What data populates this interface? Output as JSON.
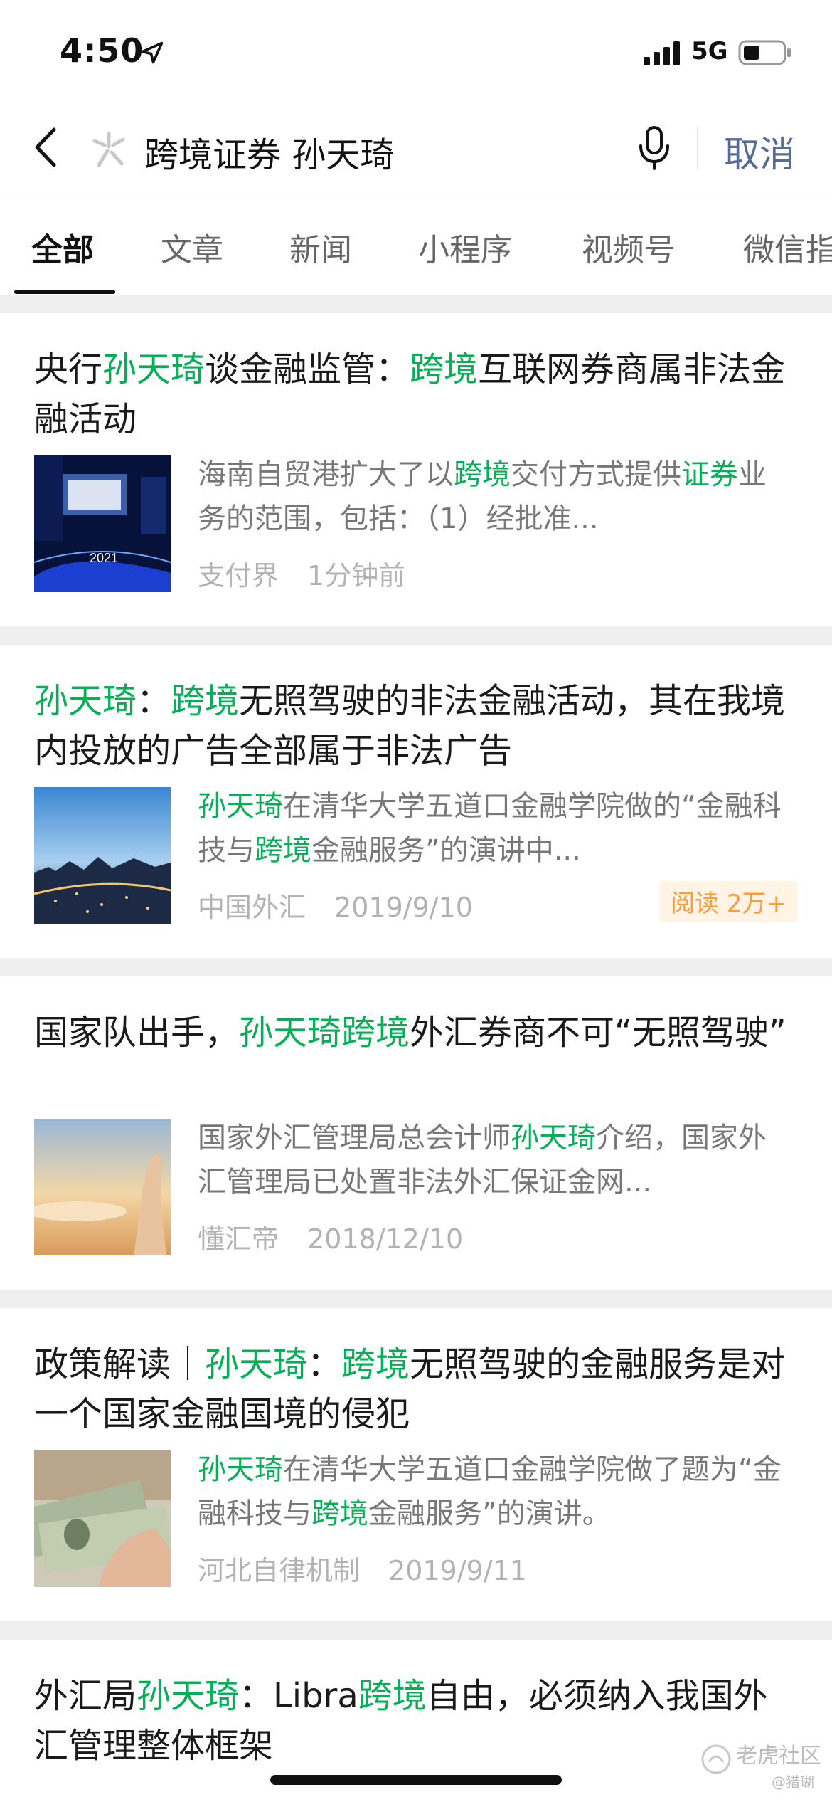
{
  "status_bar": {
    "time": "4:50",
    "network": "5G",
    "icons": [
      "location-arrow-icon",
      "signal-icon",
      "battery-icon"
    ]
  },
  "search": {
    "query": "跨境证券 孙天琦",
    "cancel_label": "取消",
    "icons": [
      "back-icon",
      "wechat-search-icon",
      "mic-icon"
    ]
  },
  "tabs": [
    {
      "label": "全部",
      "active": true
    },
    {
      "label": "文章",
      "active": false
    },
    {
      "label": "新闻",
      "active": false
    },
    {
      "label": "小程序",
      "active": false
    },
    {
      "label": "视频号",
      "active": false
    },
    {
      "label": "微信指",
      "active": false
    }
  ],
  "results": [
    {
      "title_segments": [
        {
          "text": "央行",
          "hl": false
        },
        {
          "text": "孙天琦",
          "hl": true
        },
        {
          "text": "谈金融监管：",
          "hl": false
        },
        {
          "text": "跨境",
          "hl": true
        },
        {
          "text": "互联网券商属非法金融活动",
          "hl": false
        }
      ],
      "excerpt_segments": [
        {
          "text": "海南自贸港扩大了以",
          "hl": false
        },
        {
          "text": "跨境",
          "hl": true
        },
        {
          "text": "交付方式提供",
          "hl": false
        },
        {
          "text": "证券",
          "hl": true
        },
        {
          "text": "业务的范围，包括：（1）经批准...",
          "hl": false
        }
      ],
      "source": "支付界",
      "time": "1分钟前",
      "read_badge": "",
      "thumb": "conference-stage-2021"
    },
    {
      "title_segments": [
        {
          "text": "孙天琦",
          "hl": true
        },
        {
          "text": "：",
          "hl": false
        },
        {
          "text": "跨境",
          "hl": true
        },
        {
          "text": "无照驾驶的非法金融活动，其在我境内投放的广告全部属于非法广告",
          "hl": false
        }
      ],
      "excerpt_segments": [
        {
          "text": "孙天琦",
          "hl": true
        },
        {
          "text": "在清华大学五道口金融学院做的“金融科技与",
          "hl": false
        },
        {
          "text": "跨境",
          "hl": true
        },
        {
          "text": "金融服务”的演讲中...",
          "hl": false
        }
      ],
      "source": "中国外汇",
      "time": "2019/9/10",
      "read_badge": "阅读 2万+",
      "thumb": "city-skyline-night"
    },
    {
      "title_segments": [
        {
          "text": "国家队出手，",
          "hl": false
        },
        {
          "text": "孙天琦",
          "hl": true
        },
        {
          "text": "跨境",
          "hl": true
        },
        {
          "text": "外汇券商不可“无照驾驶”",
          "hl": false
        }
      ],
      "excerpt_segments": [
        {
          "text": "国家外汇管理局总会计师",
          "hl": false
        },
        {
          "text": "孙天琦",
          "hl": true
        },
        {
          "text": "介绍，国家外汇管理局已处置非法外汇保证金网...",
          "hl": false
        }
      ],
      "source": "懂汇帝",
      "time": "2018/12/10",
      "read_badge": "",
      "thumb": "hand-sunset-sky"
    },
    {
      "title_segments": [
        {
          "text": "政策解读｜",
          "hl": false
        },
        {
          "text": "孙天琦",
          "hl": true
        },
        {
          "text": "：",
          "hl": false
        },
        {
          "text": "跨境",
          "hl": true
        },
        {
          "text": "无照驾驶的金融服务是对一个国家金融国境的侵犯",
          "hl": false
        }
      ],
      "excerpt_segments": [
        {
          "text": "孙天琦",
          "hl": true
        },
        {
          "text": "在清华大学五道口金融学院做了题为“金融科技与",
          "hl": false
        },
        {
          "text": "跨境",
          "hl": true
        },
        {
          "text": "金融服务”的演讲。",
          "hl": false
        }
      ],
      "source": "河北自律机制",
      "time": "2019/9/11",
      "read_badge": "",
      "thumb": "dollar-banknotes"
    },
    {
      "title_segments": [
        {
          "text": "外汇局",
          "hl": false
        },
        {
          "text": "孙天琦",
          "hl": true
        },
        {
          "text": "：Libra",
          "hl": false
        },
        {
          "text": "跨境",
          "hl": true
        },
        {
          "text": "自由，必须纳入我国外汇管理整体框架",
          "hl": false
        }
      ],
      "excerpt_segments": [],
      "source": "",
      "time": "",
      "read_badge": "",
      "thumb": ""
    }
  ],
  "watermark": {
    "text": "老虎社区",
    "sub": "@猎瑚"
  },
  "colors": {
    "highlight": "#06ae56",
    "cancel": "#576b95",
    "meta": "#b2b2b2",
    "badge_text": "#fa9d3b",
    "badge_bg": "#fff4e6",
    "separator": "#efefef"
  }
}
